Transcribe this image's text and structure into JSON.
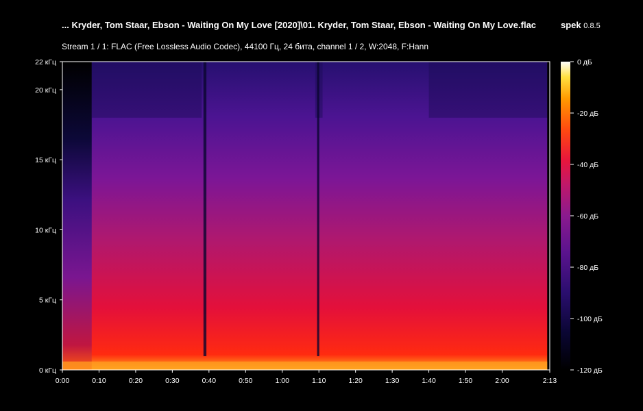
{
  "header": {
    "title": "... Kryder, Tom Staar, Ebson - Waiting On My Love [2020]\\01. Kryder, Tom Staar, Ebson - Waiting On My Love.flac",
    "app_name": "spek",
    "app_version": "0.8.5",
    "subtitle": "Stream 1 / 1: FLAC (Free Lossless Audio Codec), 44100 Гц, 24 бита, channel 1 / 2, W:2048, F:Hann"
  },
  "chart_data": {
    "type": "heatmap",
    "x_ticks": [
      "0:00",
      "0:10",
      "0:20",
      "0:30",
      "0:40",
      "0:50",
      "1:00",
      "1:10",
      "1:20",
      "1:30",
      "1:40",
      "1:50",
      "2:00",
      "2:13"
    ],
    "x_range_seconds": [
      0,
      133
    ],
    "y_ticks": [
      "0 кГц",
      "5 кГц",
      "10 кГц",
      "15 кГц",
      "20 кГц",
      "22 кГц"
    ],
    "y_range_khz": [
      0,
      22
    ],
    "colorbar_ticks": [
      "0 дБ",
      "-20 дБ",
      "-40 дБ",
      "-60 дБ",
      "-80 дБ",
      "-100 дБ",
      "-120 дБ"
    ],
    "colorbar_range_db": [
      -120,
      0
    ],
    "colormap": [
      "#000000",
      "#0a0633",
      "#2a0e6e",
      "#5a138e",
      "#8a1a8e",
      "#c0186a",
      "#e8163c",
      "#ff4a10",
      "#ff9a00",
      "#ffe040",
      "#ffffff"
    ]
  }
}
